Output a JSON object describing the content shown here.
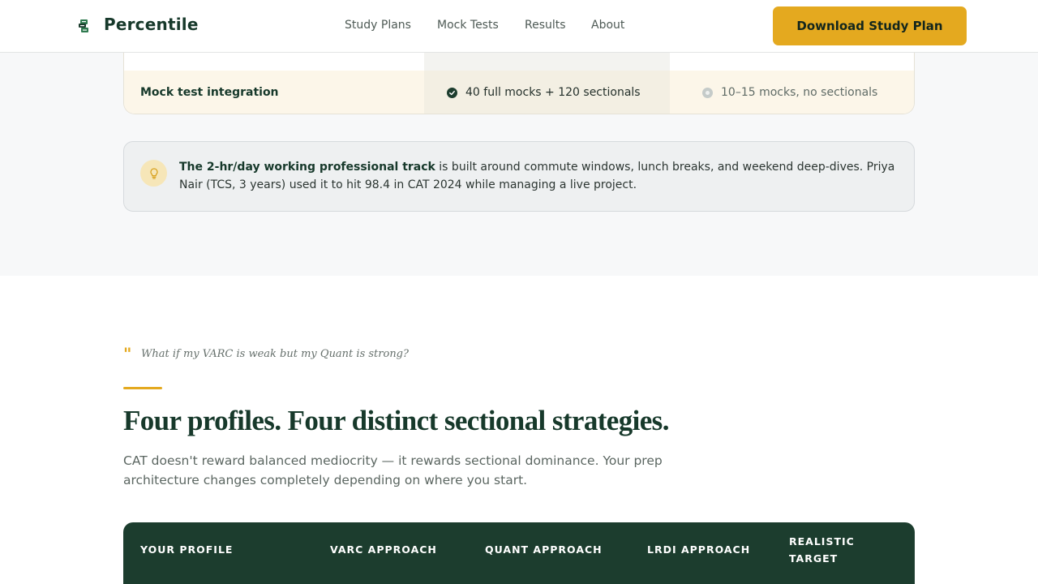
{
  "header": {
    "brand": "Percentile",
    "nav": [
      "Study Plans",
      "Mock Tests",
      "Results",
      "About"
    ],
    "cta": "Download Study Plan"
  },
  "comparison": {
    "row_label": "Mock test integration",
    "percentile_value": "40 full mocks + 120 sectionals",
    "other_value": "10–15 mocks, no sectionals"
  },
  "callout": {
    "bold": "The 2-hr/day working professional track",
    "text": " is built around commute windows, lunch breaks, and weekend deep-dives. Priya Nair (TCS, 3 years) used it to hit 98.4 in CAT 2024 while managing a live project."
  },
  "profiles": {
    "quote": "What if my VARC is weak but my Quant is strong?",
    "heading": "Four profiles. Four distinct sectional strategies.",
    "subtext": "CAT doesn't reward balanced mediocrity — it rewards sectional dominance. Your prep architecture changes completely depending on where you start.",
    "columns": [
      "YOUR PROFILE",
      "VARC APPROACH",
      "QUANT APPROACH",
      "LRDI APPROACH",
      "REALISTIC TARGET"
    ]
  },
  "icons": {
    "logo": "book-stack-icon",
    "check": "check-circle-icon",
    "neutral": "neutral-dot-icon",
    "callout": "lightbulb-icon",
    "quote": "quote-mark-icon"
  },
  "colors": {
    "brand_green": "#1c3d2e",
    "accent_gold": "#e4a91f"
  }
}
